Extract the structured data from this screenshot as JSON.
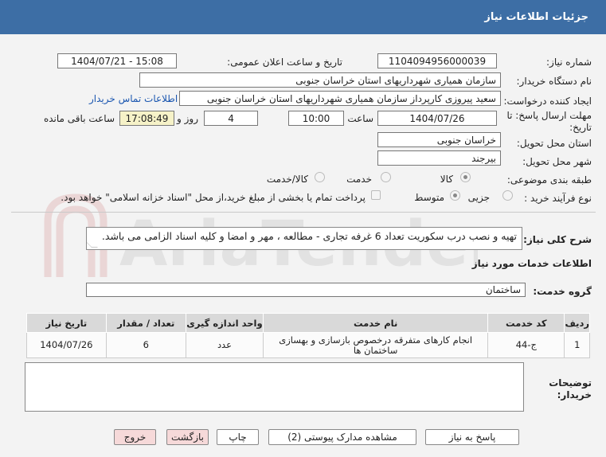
{
  "header": {
    "title": "جزئیات اطلاعات نیاز"
  },
  "form": {
    "need_number_label": "شماره نیاز:",
    "need_number": "1104094956000039",
    "announce_label": "تاریخ و ساعت اعلان عمومی:",
    "announce_value": "1404/07/21 - 15:08",
    "buyer_org_label": "نام دستگاه خریدار:",
    "buyer_org": "سازمان همیاری شهرداریهای استان خراسان جنوبی",
    "creator_label": "ایجاد کننده درخواست:",
    "creator": "سعید پیروزی کارپرداز سازمان همیاری شهرداریهای استان خراسان جنوبی",
    "contact_link": "اطلاعات تماس خریدار",
    "deadline_label": "مهلت ارسال پاسخ: تا تاریخ:",
    "deadline_date": "1404/07/26",
    "time_label": "ساعت",
    "deadline_time": "10:00",
    "days_value": "4",
    "days_label": "روز و",
    "remaining_time": "17:08:49",
    "remaining_label": "ساعت باقی مانده",
    "province_label": "استان محل تحویل:",
    "province": "خراسان جنوبی",
    "city_label": "شهر محل تحویل:",
    "city": "بیرجند",
    "category_label": "طبقه بندی موضوعی:",
    "category_options": [
      "کالا",
      "خدمت",
      "کالا/خدمت"
    ],
    "process_label": "نوع فرآیند خرید :",
    "process_options": [
      "جزیی",
      "متوسط"
    ],
    "payment_note": "پرداخت تمام یا بخشی از مبلغ خرید،از محل \"اسناد خزانه اسلامی\" خواهد بود."
  },
  "summary": {
    "label": "شرح کلی نیاز:",
    "text": "تهیه و نصب درب سکوریت تعداد 6 غرفه تجاری - مطالعه ، مهر و امضا و کلیه اسناد الزامی می باشد."
  },
  "services": {
    "section_title": "اطلاعات خدمات مورد نیاز",
    "group_label": "گروه خدمت:",
    "group_value": "ساختمان",
    "columns": [
      "ردیف",
      "کد خدمت",
      "نام خدمت",
      "واحد اندازه گیری",
      "تعداد / مقدار",
      "تاریخ نیاز"
    ],
    "rows": [
      {
        "row": "1",
        "code": "ج-44",
        "name": "انجام کارهای متفرقه درخصوص بازسازی و بهسازی ساختمان ها",
        "unit": "عدد",
        "qty": "6",
        "date": "1404/07/26"
      }
    ]
  },
  "buyer_notes": {
    "label": "توضیحات خریدار:",
    "text": ""
  },
  "buttons": {
    "reply": "پاسخ به نیاز",
    "view_docs": "مشاهده مدارک پیوستی (2)",
    "print": "چاپ",
    "back": "بازگشت",
    "exit": "خروج"
  },
  "watermark": {
    "text": "AriaTender.net"
  },
  "colors": {
    "header_bg": "#3d6ea5",
    "link": "#1a56b0",
    "remaining_bg": "#f6f2c8",
    "pink_button": "#f6d9d9"
  }
}
